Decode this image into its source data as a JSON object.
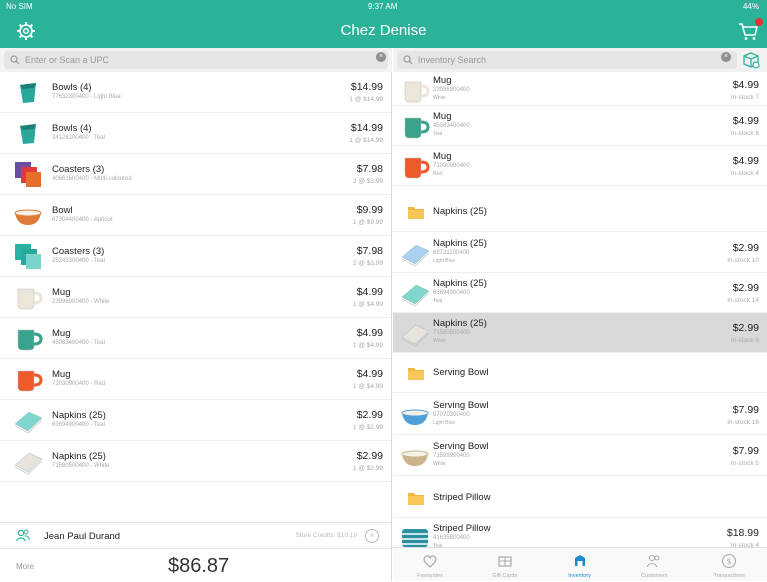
{
  "status": {
    "carrier": "No SIM",
    "time": "9:37 AM",
    "battery": "44%"
  },
  "header": {
    "title": "Chez Denise"
  },
  "cart": {
    "search_placeholder": "Enter or Scan a UPC"
  },
  "cart_items": [
    {
      "name": "Bowls (4)",
      "sub": "77632300400 - Light Blue",
      "price": "$14.99",
      "qty": "1 @ $14.99",
      "color": "#2aa89b",
      "shape": "cup"
    },
    {
      "name": "Bowls (4)",
      "sub": "34128200400 - Teal",
      "price": "$14.99",
      "qty": "1 @ $14.99",
      "color": "#2aa89b",
      "shape": "cup"
    },
    {
      "name": "Coasters (3)",
      "sub": "40661600400 - Multi-coloured",
      "price": "$7.98",
      "qty": "2 @ $3.99",
      "color": "#6a4fa3",
      "shape": "coaster-multi"
    },
    {
      "name": "Bowl",
      "sub": "67304400400 - Apricot",
      "price": "$9.99",
      "qty": "1 @ $9.99",
      "color": "#e07a3a",
      "shape": "bowl"
    },
    {
      "name": "Coasters (3)",
      "sub": "25243300400 - Teal",
      "price": "$7.98",
      "qty": "2 @ $3.99",
      "color": "#25b3a6",
      "shape": "coaster"
    },
    {
      "name": "Mug",
      "sub": "23996900400 - White",
      "price": "$4.99",
      "qty": "1 @ $4.99",
      "color": "#ece6da",
      "shape": "mug"
    },
    {
      "name": "Mug",
      "sub": "45083400400 - Teal",
      "price": "$4.99",
      "qty": "1 @ $4.99",
      "color": "#3aa38e",
      "shape": "mug"
    },
    {
      "name": "Mug",
      "sub": "71030900400 - Red",
      "price": "$4.99",
      "qty": "1 @ $4.99",
      "color": "#ef5a2b",
      "shape": "mug"
    },
    {
      "name": "Napkins (25)",
      "sub": "63694900400 - Teal",
      "price": "$2.99",
      "qty": "1 @ $2.99",
      "color": "#7fd6cf",
      "shape": "napkin"
    },
    {
      "name": "Napkins (25)",
      "sub": "71580500400 - White",
      "price": "$2.99",
      "qty": "1 @ $2.99",
      "color": "#e8e3dc",
      "shape": "napkin"
    }
  ],
  "customer": {
    "name": "Jean Paul Durand",
    "credits": "Store Credits: $10.19",
    "more": "More",
    "total": "$86.87"
  },
  "inventory": {
    "search_placeholder": "Inventory Search"
  },
  "inventory_items": [
    {
      "kind": "item",
      "name": "Mug",
      "sub": "23996900400",
      "sub2": "White",
      "price": "$4.99",
      "stock": "In-stock 7",
      "color": "#ece6da",
      "shape": "mug"
    },
    {
      "kind": "item",
      "name": "Mug",
      "sub": "45083400400",
      "sub2": "Teal",
      "price": "$4.99",
      "stock": "In-stock 8",
      "color": "#3aa38e",
      "shape": "mug"
    },
    {
      "kind": "item",
      "name": "Mug",
      "sub": "71030900400",
      "sub2": "Red",
      "price": "$4.99",
      "stock": "In-stock 4",
      "color": "#ef5a2b",
      "shape": "mug"
    },
    {
      "kind": "folder",
      "name": "Napkins (25)"
    },
    {
      "kind": "item",
      "name": "Napkins (25)",
      "sub": "69721100400",
      "sub2": "Light Blue",
      "price": "$2.99",
      "stock": "In-stock 10",
      "color": "#a9d0ee",
      "shape": "napkin"
    },
    {
      "kind": "item",
      "name": "Napkins (25)",
      "sub": "63694900400",
      "sub2": "Teal",
      "price": "$2.99",
      "stock": "In-stock 14",
      "color": "#7fd6cf",
      "shape": "napkin"
    },
    {
      "kind": "item",
      "name": "Napkins (25)",
      "sub": "71580500400",
      "sub2": "White",
      "price": "$2.99",
      "stock": "In-stock 6",
      "color": "#e8e3dc",
      "shape": "napkin",
      "selected": true
    },
    {
      "kind": "folder",
      "name": "Serving Bowl"
    },
    {
      "kind": "item",
      "name": "Serving Bowl",
      "sub": "57070300400",
      "sub2": "Light Blue",
      "price": "$7.99",
      "stock": "In-stock 16",
      "color": "#4f9fd8",
      "shape": "bowl"
    },
    {
      "kind": "item",
      "name": "Serving Bowl",
      "sub": "71599900400",
      "sub2": "White",
      "price": "$7.99",
      "stock": "In-stock 5",
      "color": "#c9b48d",
      "shape": "bowl"
    },
    {
      "kind": "folder",
      "name": "Striped Pillow"
    },
    {
      "kind": "item",
      "name": "Striped Pillow",
      "sub": "41635800400",
      "sub2": "Teal",
      "price": "$18.99",
      "stock": "In-stock 4",
      "color": "#2a8fa0",
      "shape": "pillow"
    }
  ],
  "tabs": [
    {
      "label": "Favourites",
      "icon": "heart-icon"
    },
    {
      "label": "Gift Cards",
      "icon": "gift-card-icon"
    },
    {
      "label": "Inventory",
      "icon": "inventory-icon",
      "active": true
    },
    {
      "label": "Customers",
      "icon": "customers-icon"
    },
    {
      "label": "Transactions",
      "icon": "transactions-icon"
    }
  ],
  "colors": {
    "brand": "#2bb39a",
    "active_tab": "#1a8ccc",
    "folder": "#f2b63c"
  }
}
